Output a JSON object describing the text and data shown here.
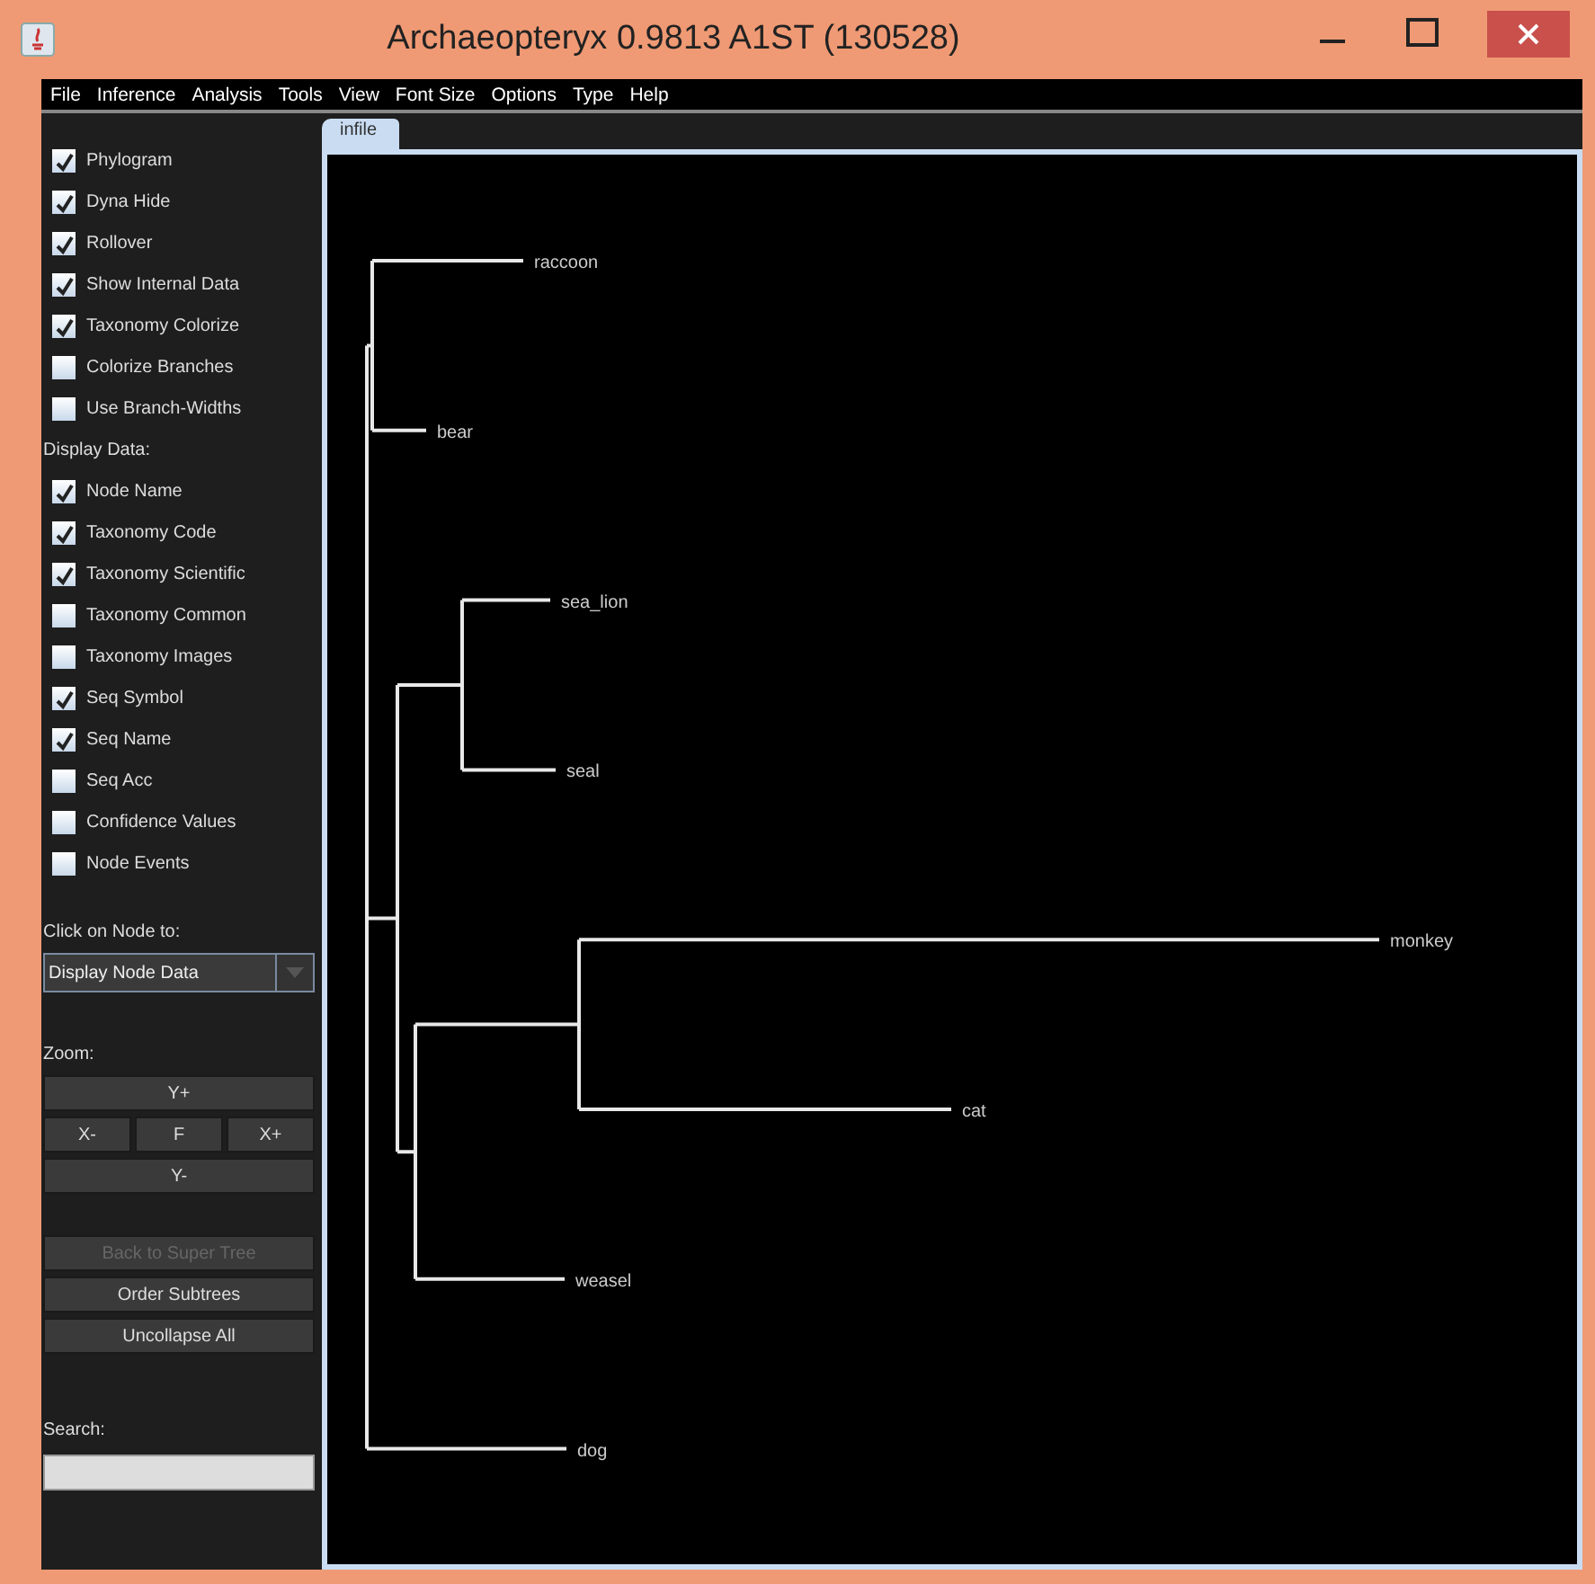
{
  "window": {
    "title": "Archaeopteryx 0.9813 A1ST (130528)"
  },
  "menu": [
    "File",
    "Inference",
    "Analysis",
    "Tools",
    "View",
    "Font Size",
    "Options",
    "Type",
    "Help"
  ],
  "options": [
    {
      "kind": "check",
      "label": "Phylogram",
      "checked": true
    },
    {
      "kind": "check",
      "label": "Dyna Hide",
      "checked": true
    },
    {
      "kind": "check",
      "label": "Rollover",
      "checked": true
    },
    {
      "kind": "check",
      "label": "Show Internal Data",
      "checked": true
    },
    {
      "kind": "check",
      "label": "Taxonomy Colorize",
      "checked": true
    },
    {
      "kind": "check",
      "label": "Colorize Branches",
      "checked": false
    },
    {
      "kind": "check",
      "label": "Use Branch-Widths",
      "checked": false
    },
    {
      "kind": "heading",
      "label": "Display Data:"
    },
    {
      "kind": "check",
      "label": "Node Name",
      "checked": true
    },
    {
      "kind": "check",
      "label": "Taxonomy Code",
      "checked": true
    },
    {
      "kind": "check",
      "label": "Taxonomy Scientific",
      "checked": true
    },
    {
      "kind": "check",
      "label": "Taxonomy Common",
      "checked": false
    },
    {
      "kind": "check",
      "label": "Taxonomy Images",
      "checked": false
    },
    {
      "kind": "check",
      "label": "Seq Symbol",
      "checked": true
    },
    {
      "kind": "check",
      "label": "Seq Name",
      "checked": true
    },
    {
      "kind": "check",
      "label": "Seq Acc",
      "checked": false
    },
    {
      "kind": "check",
      "label": "Confidence Values",
      "checked": false
    },
    {
      "kind": "check",
      "label": "Node Events",
      "checked": false
    }
  ],
  "click_label": "Click on Node to:",
  "click_select": {
    "value": "Display Node Data"
  },
  "zoom_label": "Zoom:",
  "zoom_buttons": {
    "y_plus": "Y+",
    "x_minus": "X-",
    "fit": "F",
    "x_plus": "X+",
    "y_minus": "Y-"
  },
  "actions": [
    {
      "label": "Back to Super Tree",
      "disabled": true
    },
    {
      "label": "Order Subtrees",
      "disabled": false
    },
    {
      "label": "Uncollapse All",
      "disabled": false
    }
  ],
  "search_label": "Search:",
  "tabs": [
    {
      "label": "infile",
      "selected": true
    }
  ],
  "tree": {
    "children": [
      {
        "children": [
          {
            "name": "raccoon"
          },
          {
            "name": "bear"
          }
        ]
      },
      {
        "children": [
          {
            "children": [
              {
                "name": "sea_lion"
              },
              {
                "name": "seal"
              }
            ]
          },
          {
            "children": [
              {
                "children": [
                  {
                    "name": "monkey"
                  },
                  {
                    "name": "cat"
                  }
                ]
              },
              {
                "name": "weasel"
              }
            ]
          }
        ]
      },
      {
        "name": "dog"
      }
    ]
  }
}
